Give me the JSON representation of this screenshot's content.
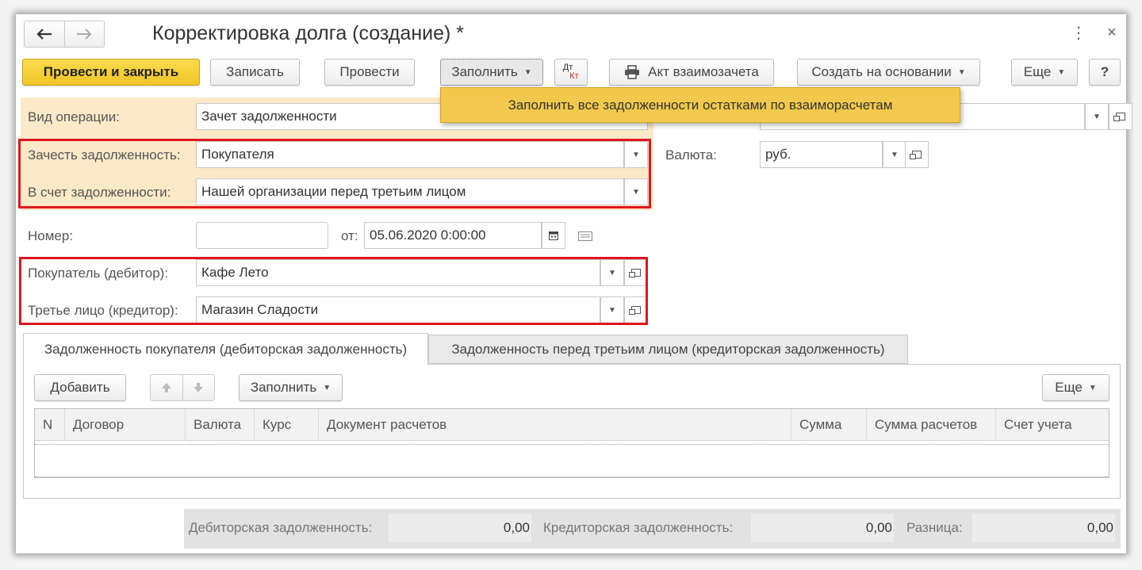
{
  "window": {
    "title": "Корректировка долга (создание) *"
  },
  "toolbar": {
    "post_close": "Провести и закрыть",
    "save": "Записать",
    "post": "Провести",
    "fill": "Заполнить",
    "dtkt_top": "Дт",
    "dtkt_bottom": "Кт",
    "act": "Акт взаимозачета",
    "create_based": "Создать на основании",
    "more": "Еще",
    "help": "?"
  },
  "fill_menu": {
    "item": "Заполнить все задолженности остатками по взаиморасчетам"
  },
  "form": {
    "operation_label": "Вид операции:",
    "operation_value": "Зачет задолженности",
    "offset_label": "Зачесть задолженность:",
    "offset_value": "Покупателя",
    "against_label": "В счет задолженности:",
    "against_value": "Нашей организации перед третьим лицом",
    "currency_label": "Валюта:",
    "currency_value": "руб.",
    "number_label": "Номер:",
    "number_value": "",
    "date_label": "от:",
    "date_value": "05.06.2020  0:00:00",
    "buyer_label": "Покупатель (дебитор):",
    "buyer_value": "Кафе Лето",
    "third_label": "Третье лицо (кредитор):",
    "third_value": "Магазин Сладости"
  },
  "tabs": [
    {
      "label": "Задолженность покупателя (дебиторская задолженность)",
      "active": true
    },
    {
      "label": "Задолженность перед третьим лицом (кредиторская задолженность)",
      "active": false
    }
  ],
  "table_toolbar": {
    "add": "Добавить",
    "fill": "Заполнить",
    "more": "Еще"
  },
  "table": {
    "columns": [
      "N",
      "Договор",
      "Валюта",
      "Курс",
      "Документ расчетов",
      "Сумма",
      "Сумма расчетов",
      "Счет учета"
    ],
    "rows": []
  },
  "footer": {
    "debit_label": "Дебиторская задолженность:",
    "debit_value": "0,00",
    "credit_label": "Кредиторская задолженность:",
    "credit_value": "0,00",
    "diff_label": "Разница:",
    "diff_value": "0,00"
  },
  "icons": {
    "back": "arrow-left-icon",
    "forward": "arrow-right-icon",
    "menu": "kebab-menu-icon",
    "close": "close-icon",
    "print": "printer-icon",
    "calendar": "calendar-icon",
    "comment": "comment-icon",
    "open": "open-form-icon"
  },
  "colors": {
    "primary_button": "#f5d033",
    "highlight_area": "#fbe9c8",
    "red_frame": "#e0161e",
    "menu_bg": "#f2c94c"
  }
}
